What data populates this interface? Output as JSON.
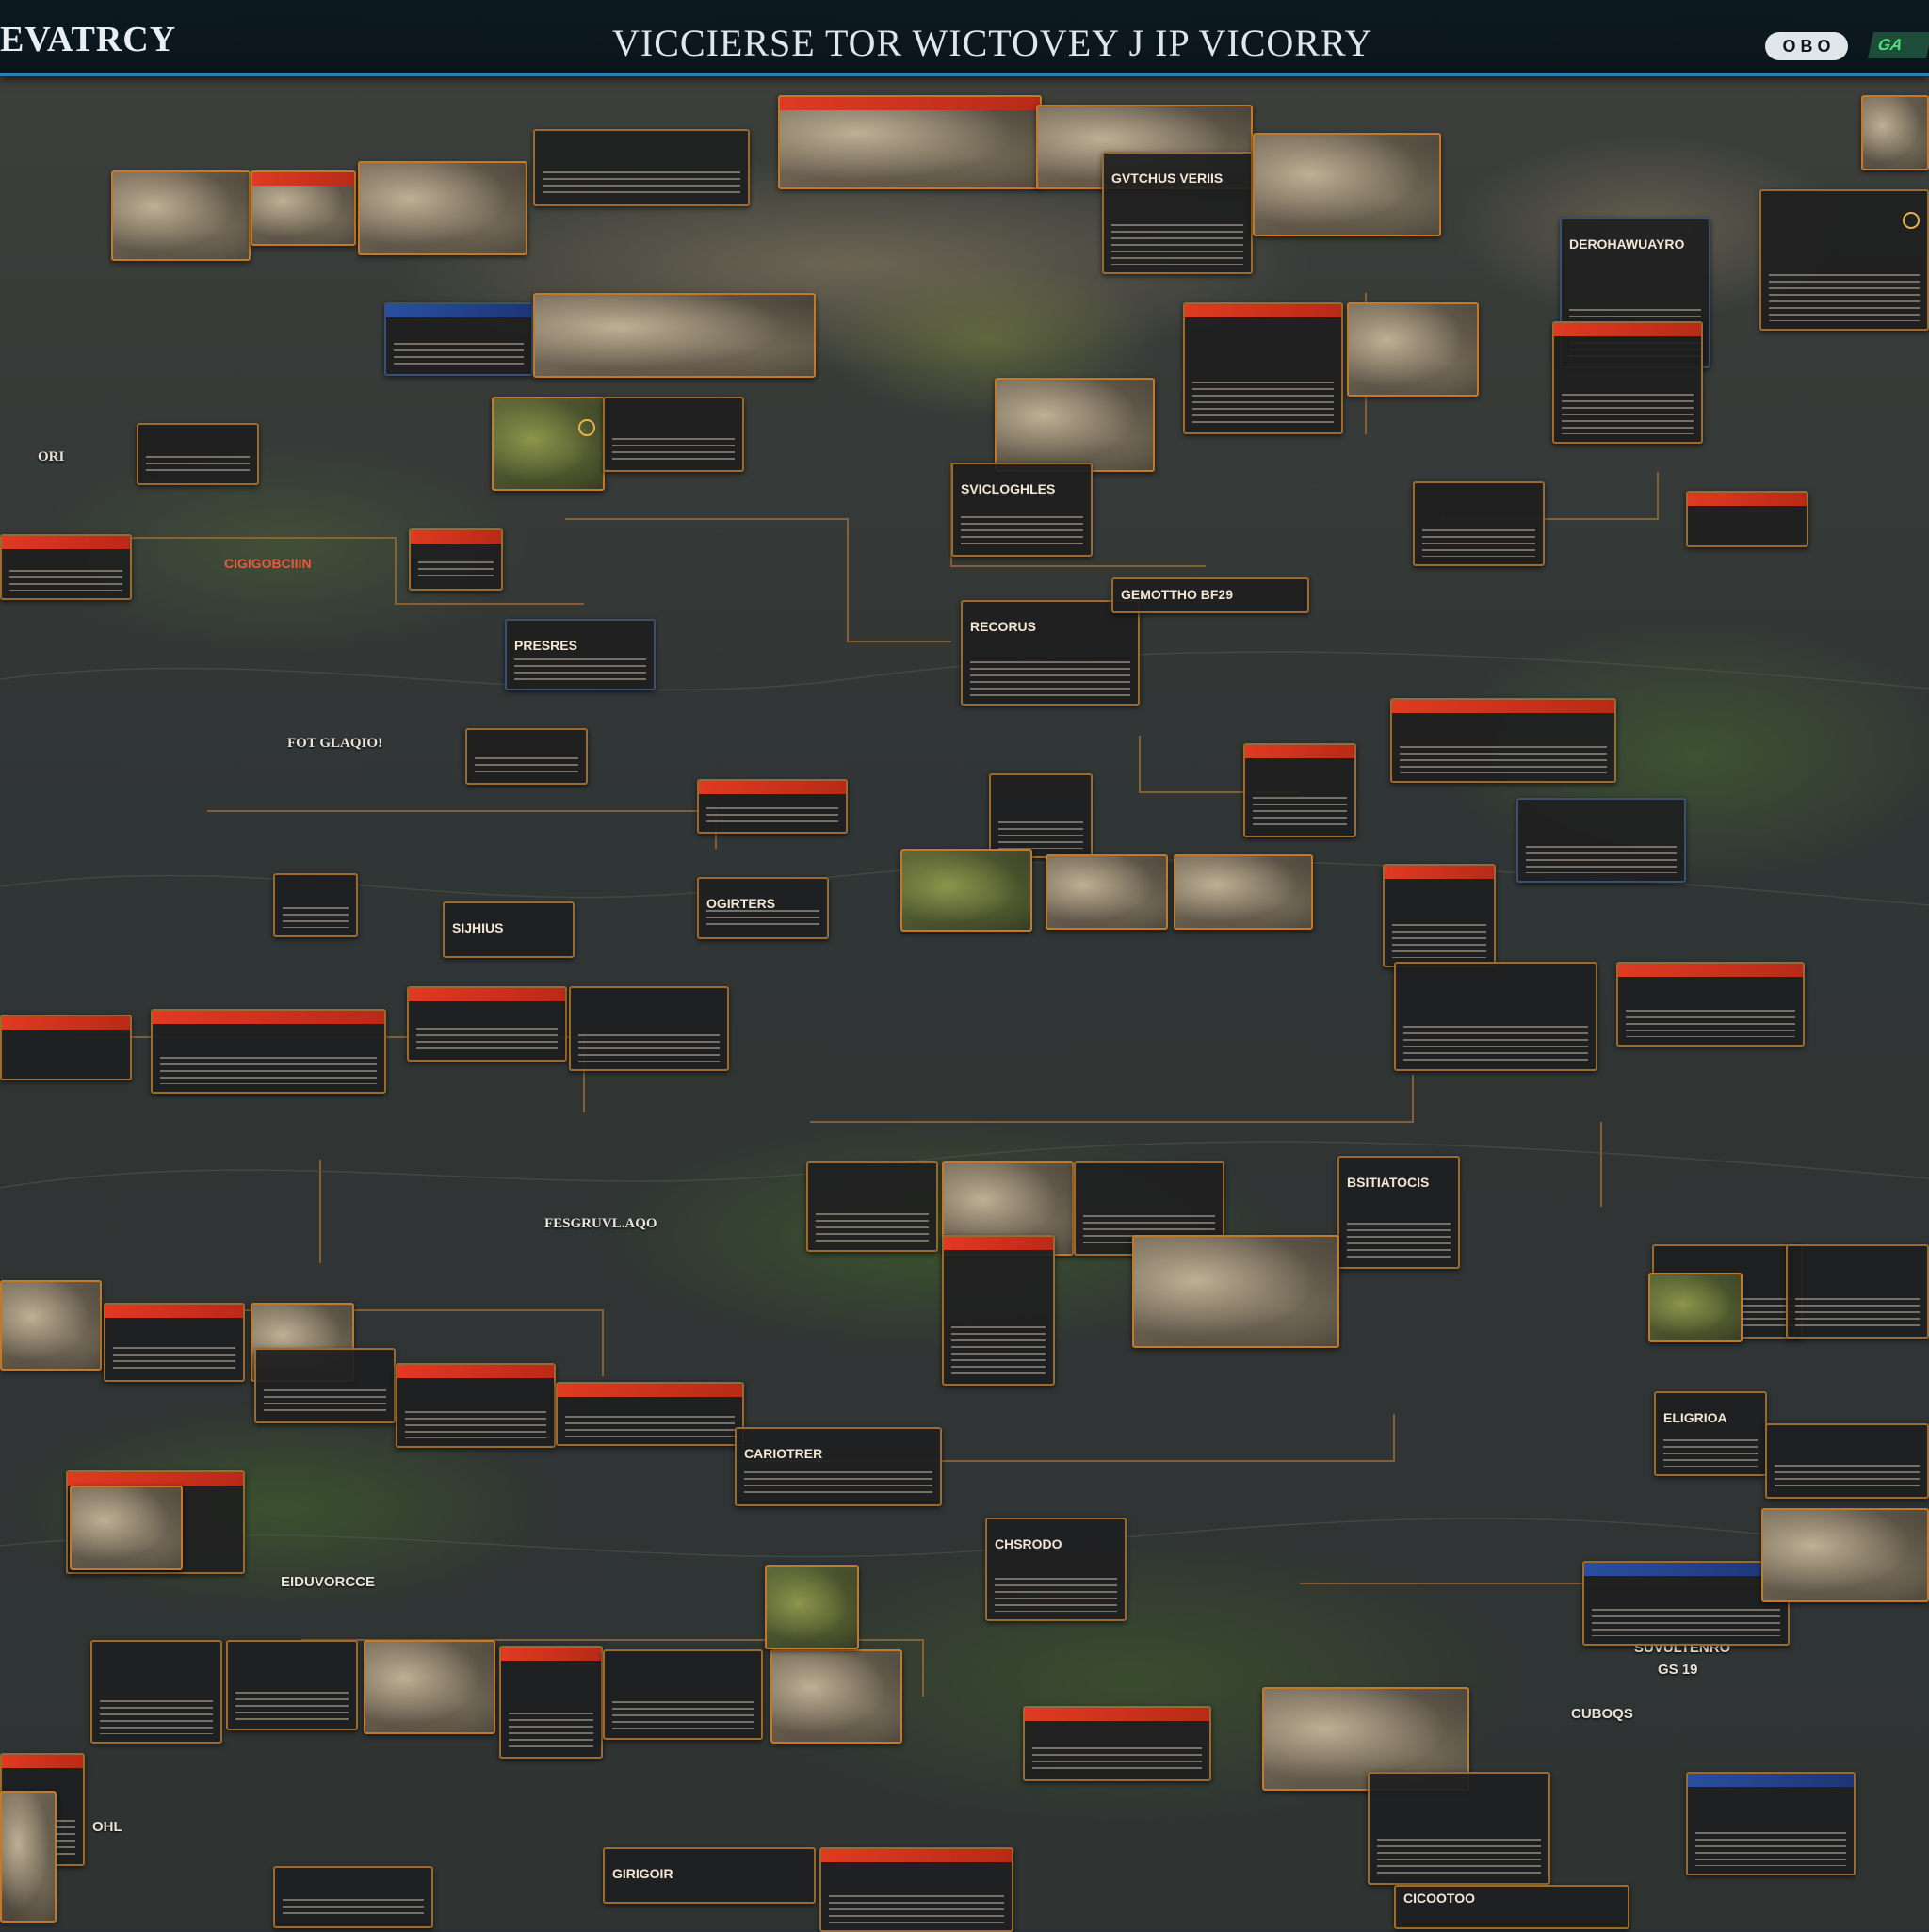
{
  "header": {
    "brand": "EVATRCY",
    "title": "VICCIERSE TOR WICTOVEY J IP VICORRY",
    "right_pill": "O B O",
    "right_badge": "GA"
  },
  "map_labels": [
    {
      "id": "ori",
      "text": "ORI"
    },
    {
      "id": "for-glaqio",
      "text": "FOT GLAQIO!"
    },
    {
      "id": "fesgruvl",
      "text": "FESGRUVL.AQO"
    },
    {
      "id": "suvultenro",
      "text": "SUVULTENRO"
    },
    {
      "id": "eiduvorcce",
      "text": "EIDUVORCCE"
    },
    {
      "id": "cuboqs",
      "text": "CUBOQS"
    },
    {
      "id": "gs19",
      "text": "GS 19"
    },
    {
      "id": "ohl",
      "text": "OHL"
    }
  ],
  "cards": [
    {
      "text": "GVTCHUS VERIIS"
    },
    {
      "text": "DEROHAWUAYRO"
    },
    {
      "text": "SVICLOGHLES"
    },
    {
      "text": "RECORUS"
    },
    {
      "text": "GEMOTTHO BF29"
    },
    {
      "text": "PRESRES"
    },
    {
      "text": "CIGIGOBCIIIN"
    },
    {
      "text": "OGIRTERS"
    },
    {
      "text": "SIJHIUS"
    },
    {
      "text": "BSITIATOCIS"
    },
    {
      "text": "CARIOTRER"
    },
    {
      "text": "ELIGRIOA"
    },
    {
      "text": "CHSRODO"
    },
    {
      "text": "GIRIGOIR"
    },
    {
      "text": "CICOOTOO"
    }
  ],
  "colors": {
    "accent_orange": "#c27a2a",
    "accent_red": "#e03a22",
    "accent_blue": "#2a7fb3"
  }
}
